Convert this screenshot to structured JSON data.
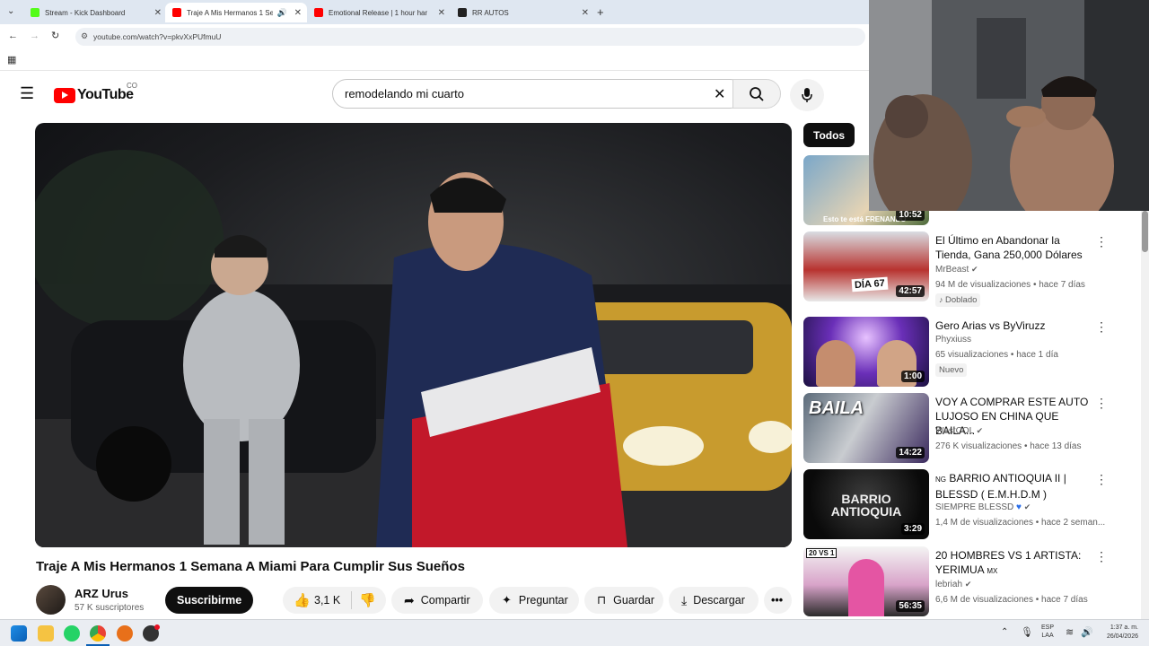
{
  "browser": {
    "tabs": [
      {
        "label": "Stream - Kick Dashboard",
        "color": "#53fc18"
      },
      {
        "label": "Traje A Mis Hermanos 1 Ser",
        "color": "#ff0000"
      },
      {
        "label": "Emotional Release | 1 hour han",
        "color": "#ff0000"
      },
      {
        "label": "RR AUTOS",
        "color": "#222222"
      }
    ],
    "url": "youtube.com/watch?v=pkvXxPUfmuU"
  },
  "youtube": {
    "logo_text": "YouTube",
    "country": "CO",
    "search_value": "remodelando mi cuarto"
  },
  "video": {
    "title": "Traje A Mis Hermanos 1 Semana A Miami Para Cumplir Sus Sueños",
    "channel": "ARZ Urus",
    "subscribers": "57 K suscriptores",
    "subscribe_label": "Suscribirme",
    "likes": "3,1 K",
    "share_label": "Compartir",
    "ask_label": "Preguntar",
    "save_label": "Guardar",
    "download_label": "Descargar"
  },
  "sidebar": {
    "chip_all": "Todos",
    "first_thumb_caption": "Esto te está FRENANDO",
    "first_duration": "10:52",
    "items": [
      {
        "title": "El Último en Abandonar la Tienda, Gana 250,000 Dólares",
        "channel": "MrBeast",
        "meta": "94 M de visualizaciones • hace 7 días",
        "badge": "Doblado",
        "duration": "42:57",
        "thumb_text": "DÍA 67"
      },
      {
        "title": "Gero Arias vs ByViruzz",
        "channel": "Phyxiuss",
        "meta": "65 visualizaciones • hace 1 día",
        "badge": "Nuevo",
        "duration": "1:00",
        "thumb_text": ""
      },
      {
        "title": "VOY A COMPRAR ESTE AUTO LUJOSO EN CHINA QUE BAILA...",
        "channel": "WestCOL",
        "meta": "276 K visualizaciones • hace 13 días",
        "badge": "",
        "duration": "14:22",
        "thumb_text": "BAILA"
      },
      {
        "title": "BARRIO ANTIOQUIA II | BLESSD ( E.M.H.D.M )",
        "title_prefix": "NG",
        "channel": "SIEMPRE BLESSD",
        "meta": "1,4 M de visualizaciones • hace 2 seman...",
        "badge": "",
        "duration": "3:29",
        "thumb_text": "BARRIO ANTIOQUIA"
      },
      {
        "title": "20 HOMBRES VS 1 ARTISTA: YERIMUA",
        "title_suffix": "MX",
        "channel": "lebriah",
        "meta": "6,6 M de visualizaciones • hace 7 días",
        "badge": "",
        "duration": "56:35",
        "thumb_text": "20 VS 1"
      }
    ]
  },
  "taskbar": {
    "lang_top": "ESP",
    "lang_bottom": "LAA",
    "time": "1:37 a. m.",
    "date": "26/04/2026"
  }
}
